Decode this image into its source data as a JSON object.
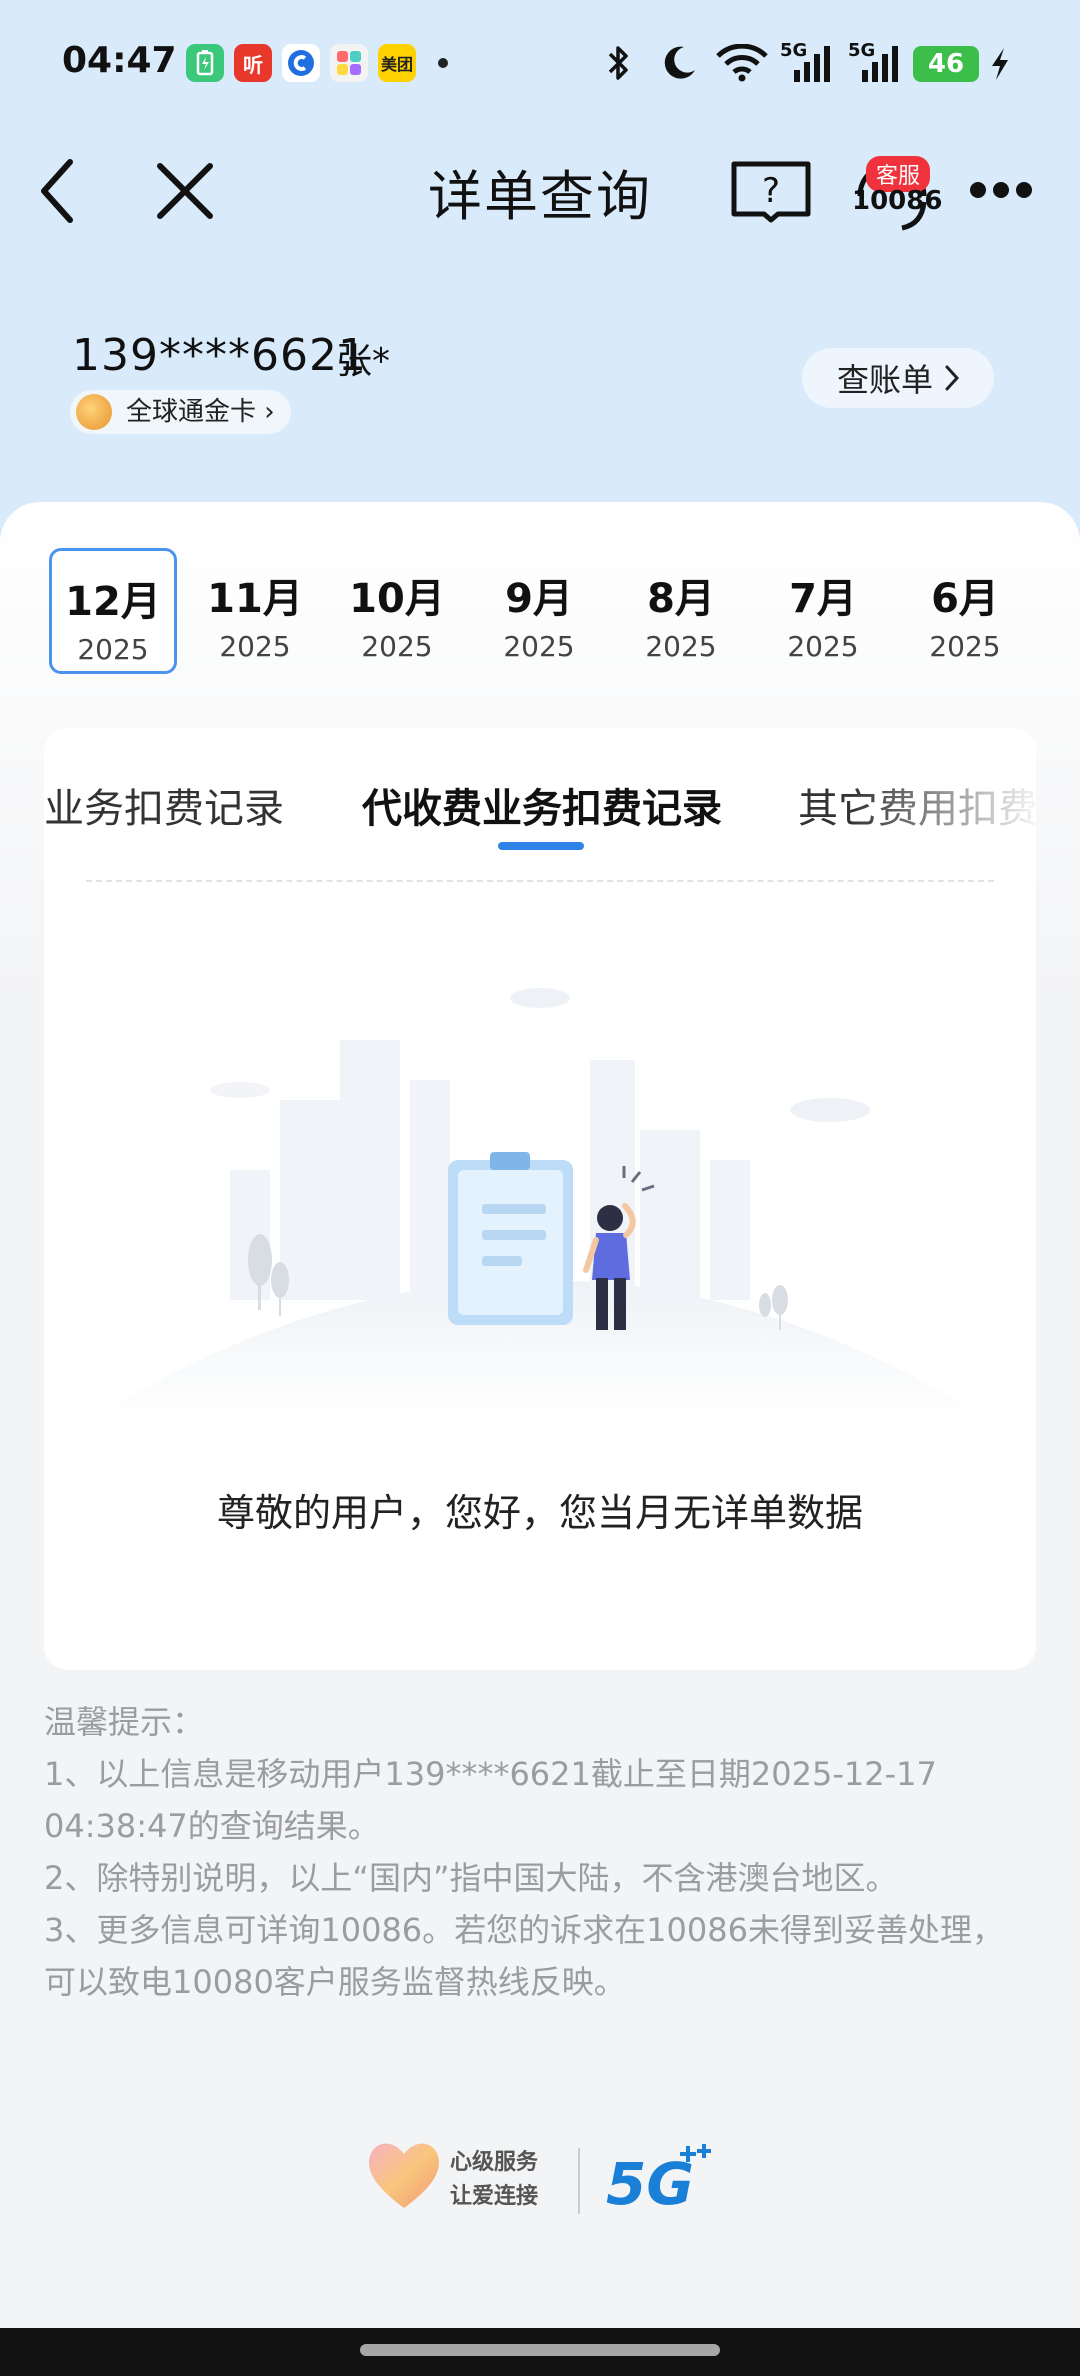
{
  "status_bar": {
    "time": "04:47",
    "network_1": "5G",
    "network_2": "5G",
    "battery": "46",
    "apps": [
      {
        "name": "battery-app",
        "text": "",
        "color": "#3cc87a"
      },
      {
        "name": "listen-app",
        "text": "听",
        "color": "#e8382c"
      },
      {
        "name": "browser-app",
        "text": "",
        "color": "#1f6fe0"
      },
      {
        "name": "gallery-app",
        "text": "",
        "color": "#f3f3f3"
      },
      {
        "name": "meituan-app",
        "text": "美团",
        "color": "#ffd100"
      }
    ]
  },
  "nav": {
    "title": "详单查询",
    "cs_badge": "客服",
    "cs_number": "10086"
  },
  "account": {
    "phone": "139****6621",
    "name": "张*",
    "card_type": "全球通金卡 ›",
    "bill_button": "查账单"
  },
  "months": [
    {
      "month": "12月",
      "year": "2025",
      "selected": true
    },
    {
      "month": "11月",
      "year": "2025",
      "selected": false
    },
    {
      "month": "10月",
      "year": "2025",
      "selected": false
    },
    {
      "month": "9月",
      "year": "2025",
      "selected": false
    },
    {
      "month": "8月",
      "year": "2025",
      "selected": false
    },
    {
      "month": "7月",
      "year": "2025",
      "selected": false
    },
    {
      "month": "6月",
      "year": "2025",
      "selected": false
    }
  ],
  "tabs": {
    "left": "业务扣费记录",
    "active": "代收费业务扣费记录",
    "right": "其它费用扣费"
  },
  "empty_message": "尊敬的用户，您好，您当月无详单数据",
  "tips": {
    "title": "温馨提示：",
    "line1": "1、以上信息是移动用户139****6621截止至日期2025-12-17 04:38:47的查询结果。",
    "line2": "2、除特别说明，以上“国内”指中国大陆，不含港澳台地区。",
    "line3": "3、更多信息可详询10086。若您的诉求在10086未得到妥善处理，可以致电10080客户服务监督热线反映。"
  },
  "footer": {
    "slogan_1": "心级服务",
    "slogan_2": "让爱连接",
    "brand": "5G"
  },
  "colors": {
    "accent": "#2f83e8",
    "header_bg": "#d9ebfb"
  }
}
